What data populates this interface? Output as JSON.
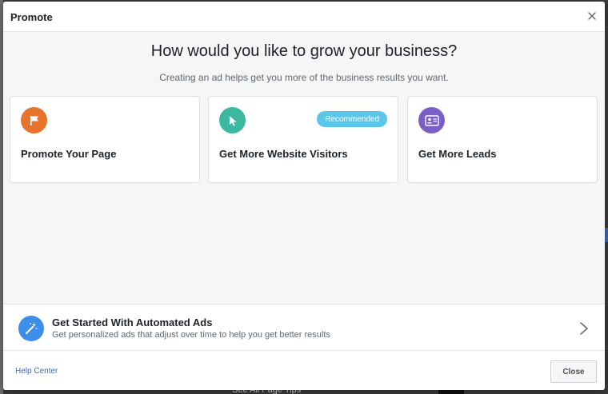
{
  "dialog": {
    "title": "Promote",
    "close_glyph": "×"
  },
  "main": {
    "headline": "How would you like to grow your business?",
    "subline": "Creating an ad helps get you more of the business results you want."
  },
  "cards": [
    {
      "label": "Promote Your Page",
      "icon": "flag-icon",
      "color": "#e8732d"
    },
    {
      "label": "Get More Website Visitors",
      "icon": "cursor-icon",
      "color": "#3cb7a2",
      "badge": "Recommended"
    },
    {
      "label": "Get More Leads",
      "icon": "contact-card-icon",
      "color": "#7b5fc8"
    }
  ],
  "automated": {
    "title": "Get Started With Automated Ads",
    "description": "Get personalized ads that adjust over time to help you get better results",
    "icon": "magic-wand-icon",
    "color": "#3b8ee9"
  },
  "footer": {
    "help_label": "Help Center",
    "close_label": "Close"
  },
  "background": {
    "bottom_text": "See All Page Tips"
  },
  "colors": {
    "badge": "#5ac7ea",
    "link": "#4267b2"
  }
}
